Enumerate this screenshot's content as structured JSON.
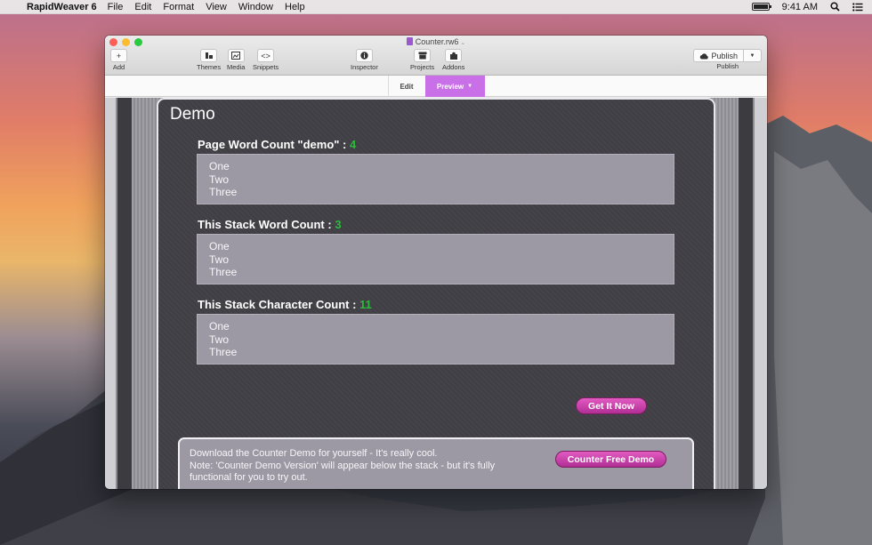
{
  "menubar": {
    "app_name": "RapidWeaver 6",
    "menus": [
      "File",
      "Edit",
      "Format",
      "View",
      "Window",
      "Help"
    ],
    "time": "9:41 AM",
    "battery_level": 1.0
  },
  "window": {
    "document_title": "Counter.rw6",
    "toolbar": {
      "add": "Add",
      "themes": "Themes",
      "media": "Media",
      "snippets": "Snippets",
      "inspector": "Inspector",
      "projects": "Projects",
      "addons": "Addons",
      "publish_button": "Publish",
      "publish_label": "Publish"
    },
    "modes": {
      "edit": "Edit",
      "preview": "Preview"
    }
  },
  "page": {
    "title": "Demo",
    "sections": [
      {
        "heading": "Page Word Count \"demo\" : ",
        "count": "4",
        "lines": [
          "One",
          "Two",
          "Three"
        ]
      },
      {
        "heading": "This Stack Word Count : ",
        "count": "3",
        "lines": [
          "One",
          "Two",
          "Three"
        ]
      },
      {
        "heading": "This Stack Character Count : ",
        "count": "11",
        "lines": [
          "One",
          "Two",
          "Three"
        ]
      }
    ],
    "get_it_now": "Get It Now",
    "download": {
      "line1": "Download the Counter Demo for yourself - It's really cool.",
      "line2": "Note: 'Counter Demo Version' will appear below the stack - but it's fully functional for you to try out.",
      "button": "Counter Free Demo"
    }
  },
  "colors": {
    "preview_tab": "#c970e8",
    "count_green": "#2bbb3a",
    "pill_magenta": "#c940a8"
  }
}
